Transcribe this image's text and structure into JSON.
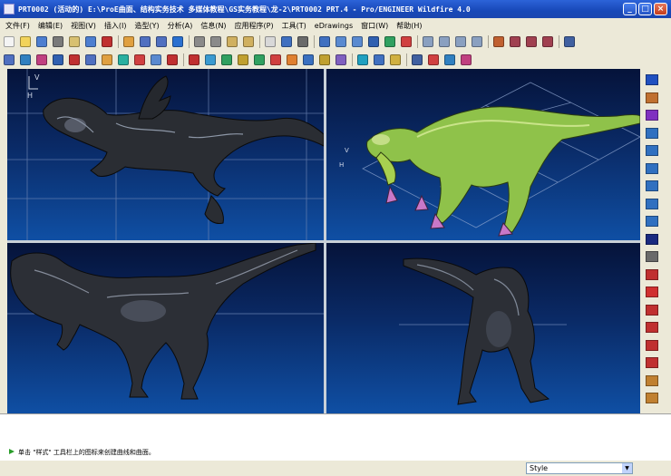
{
  "window": {
    "title": "PRT0002 (活动的) E:\\ProE曲面、结构实务技术 多媒体教程\\GS实务教程\\龙-2\\PRT0002 PRT.4 - Pro/ENGINEER Wildfire 4.0",
    "min": "_",
    "max": "□",
    "close": "×"
  },
  "menubar": {
    "items": [
      "文件(F)",
      "编辑(E)",
      "视图(V)",
      "插入(I)",
      "造型(Y)",
      "分析(A)",
      "信息(N)",
      "应用程序(P)",
      "工具(T)",
      "eDrawings",
      "窗口(W)",
      "帮助(H)"
    ]
  },
  "toolbar1": {
    "icons": [
      "new-icon",
      "open-icon",
      "save-icon",
      "print-icon",
      "email-icon",
      "save-copy-icon",
      "close-window-icon",
      "|",
      "regenerate-icon",
      "undo-icon",
      "redo-icon",
      "repaint-icon",
      "|",
      "cut-icon",
      "copy-icon",
      "paste-icon",
      "paste-special-icon",
      "|",
      "model-tree-icon",
      "selection-filter-icon",
      "dropdown-icon",
      "|",
      "orient-icon",
      "zoom-in-icon",
      "zoom-out-icon",
      "refit-icon",
      "spin-icon",
      "appearance-icon",
      "|",
      "wireframe-icon",
      "hidden-line-icon",
      "no-hidden-icon",
      "shading-icon",
      "|",
      "datum-planes-icon",
      "datum-axes-icon",
      "datum-points-icon",
      "coord-sys-icon",
      "|",
      "view-manager-icon"
    ],
    "colors": [
      "#f4f4f4",
      "#f2d35a",
      "#4d7ed0",
      "#7a7a7a",
      "#d8c070",
      "#4d7ed0",
      "#c03030",
      "|",
      "#e0a040",
      "#5070c0",
      "#5070c0",
      "#2a70d0",
      "|",
      "#8a8a8a",
      "#8a8a8a",
      "#d0b060",
      "#d0b060",
      "|",
      "#d8d8d8",
      "#4070c0",
      "#6a6a6a",
      "|",
      "#4070c0",
      "#5a8ad0",
      "#5a8ad0",
      "#3060b0",
      "#30a060",
      "#d04040",
      "|",
      "#8aa0c0",
      "#8aa0c0",
      "#8aa0c0",
      "#8aa0c0",
      "|",
      "#c06030",
      "#a04050",
      "#a04050",
      "#a04050",
      "|",
      "#4060a0"
    ]
  },
  "toolbar2": {
    "icons": [
      "style-surface-icon",
      "curve-icon",
      "curve-from-surface-icon",
      "surface-icon",
      "trim-icon",
      "edit-curve-icon",
      "boundary-blend-icon",
      "curvature-icon",
      "connect-icon",
      "offset-icon",
      "delete-icon",
      "|",
      "analysis-icon",
      "draft-check-icon",
      "slope-icon",
      "reflection-icon",
      "dihedral-icon",
      "curvature-analysis-icon",
      "color-icon",
      "light-icon",
      "hand-icon",
      "section-icon",
      "|",
      "render-icon",
      "environment-icon",
      "lamp-icon",
      "|",
      "scene-icon",
      "room-icon",
      "photo-icon",
      "material-icon"
    ],
    "colors": [
      "#5070c0",
      "#3080c0",
      "#c04080",
      "#3060b0",
      "#c03030",
      "#5070c0",
      "#e0a040",
      "#2ab0a0",
      "#d04040",
      "#5a8ad0",
      "#c03030",
      "|",
      "#c03030",
      "#3a9ad0",
      "#30a060",
      "#c0a030",
      "#30a060",
      "#d04040",
      "#e08030",
      "#3a70c0",
      "#c0a030",
      "#8060c0",
      "|",
      "#20a0c0",
      "#4070c0",
      "#d0b040",
      "|",
      "#4060a0",
      "#d04040",
      "#3080c0",
      "#c04080"
    ]
  },
  "righttoolbar": {
    "icons": [
      "select-arrow-icon",
      "plane-icon",
      "curve-icon",
      "surface-icon",
      "boundary-icon",
      "extend-icon",
      "trim-icon",
      "offset-icon",
      "copy-surface-icon",
      "checkmark-icon",
      "sketch-icon",
      "plane-sketch-icon",
      "line-icon",
      "spline-icon",
      "intersect-icon",
      "project-icon",
      "point-icon",
      "wrap-icon",
      "datum-icon"
    ],
    "colors": [
      "#2050c0",
      "#c07030",
      "#8030c0",
      "#3070c0",
      "#3070c0",
      "#3070c0",
      "#3070c0",
      "#3070c0",
      "#3070c0",
      "#1a2a80",
      "#6a6a6a",
      "#c03030",
      "#d03030",
      "#c03030",
      "#c03030",
      "#c03030",
      "#c03030",
      "#c08030",
      "#c08030"
    ]
  },
  "message_area": {
    "message": "单击 \"样式\" 工具栏上的图标来创建曲线和曲面。"
  },
  "status_bar": {
    "style_value": "Style",
    "dropdown_glyph": "▼"
  },
  "viewports": {
    "top_left": {
      "orientation_label_1": "V",
      "orientation_label_2": "H"
    },
    "top_right": {
      "orientation_label_1": "V",
      "orientation_label_2": "H"
    }
  }
}
